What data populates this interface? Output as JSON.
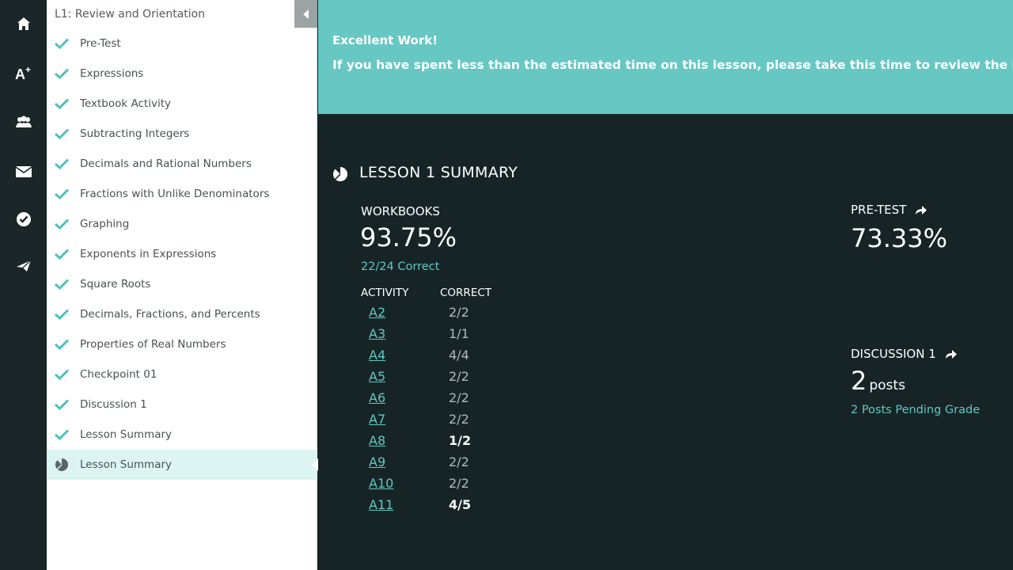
{
  "rail": {
    "icons": [
      "home-icon",
      "grades-icon",
      "people-icon",
      "mail-icon",
      "check-circle-icon",
      "send-icon"
    ]
  },
  "nav": {
    "title": "L1: Review and Orientation",
    "items": [
      {
        "label": "Pre-Test",
        "status": "complete"
      },
      {
        "label": "Expressions",
        "status": "complete"
      },
      {
        "label": "Textbook Activity",
        "status": "complete"
      },
      {
        "label": "Subtracting Integers",
        "status": "complete"
      },
      {
        "label": "Decimals and Rational Numbers",
        "status": "complete"
      },
      {
        "label": "Fractions with Unlike Denominators",
        "status": "complete"
      },
      {
        "label": "Graphing",
        "status": "complete"
      },
      {
        "label": "Exponents in Expressions",
        "status": "complete"
      },
      {
        "label": "Square Roots",
        "status": "complete"
      },
      {
        "label": "Decimals, Fractions, and Percents",
        "status": "complete"
      },
      {
        "label": "Properties of Real Numbers",
        "status": "complete"
      },
      {
        "label": "Checkpoint 01",
        "status": "complete"
      },
      {
        "label": "Discussion 1",
        "status": "complete"
      },
      {
        "label": "Lesson Summary",
        "status": "complete"
      },
      {
        "label": "Lesson Summary",
        "status": "current"
      }
    ]
  },
  "banner": {
    "title": "Excellent Work!",
    "text": "If you have spent less than the estimated time on this lesson, please take this time to review the lesson."
  },
  "summary": {
    "title": "LESSON 1 SUMMARY",
    "workbooks": {
      "label": "WORKBOOKS",
      "value": "93.75%",
      "correct": "22/24 Correct",
      "col_activity": "ACTIVITY",
      "col_correct": "CORRECT",
      "rows": [
        {
          "activity": "A2",
          "score": "2/2",
          "full": true
        },
        {
          "activity": "A3",
          "score": "1/1",
          "full": true
        },
        {
          "activity": "A4",
          "score": "4/4",
          "full": true
        },
        {
          "activity": "A5",
          "score": "2/2",
          "full": true
        },
        {
          "activity": "A6",
          "score": "2/2",
          "full": true
        },
        {
          "activity": "A7",
          "score": "2/2",
          "full": true
        },
        {
          "activity": "A8",
          "score": "1/2",
          "full": false
        },
        {
          "activity": "A9",
          "score": "2/2",
          "full": true
        },
        {
          "activity": "A10",
          "score": "2/2",
          "full": true
        },
        {
          "activity": "A11",
          "score": "4/5",
          "full": false
        }
      ]
    },
    "pretest": {
      "label": "PRE-TEST",
      "value": "73.33%"
    },
    "discussion": {
      "label": "DISCUSSION 1",
      "count": "2",
      "unit": "posts",
      "pending": "2 Posts Pending Grade"
    }
  },
  "colors": {
    "accent": "#66c7c3",
    "link": "#5fc9c3",
    "dark_bg": "#172426",
    "active_row": "#dcf5f3"
  }
}
